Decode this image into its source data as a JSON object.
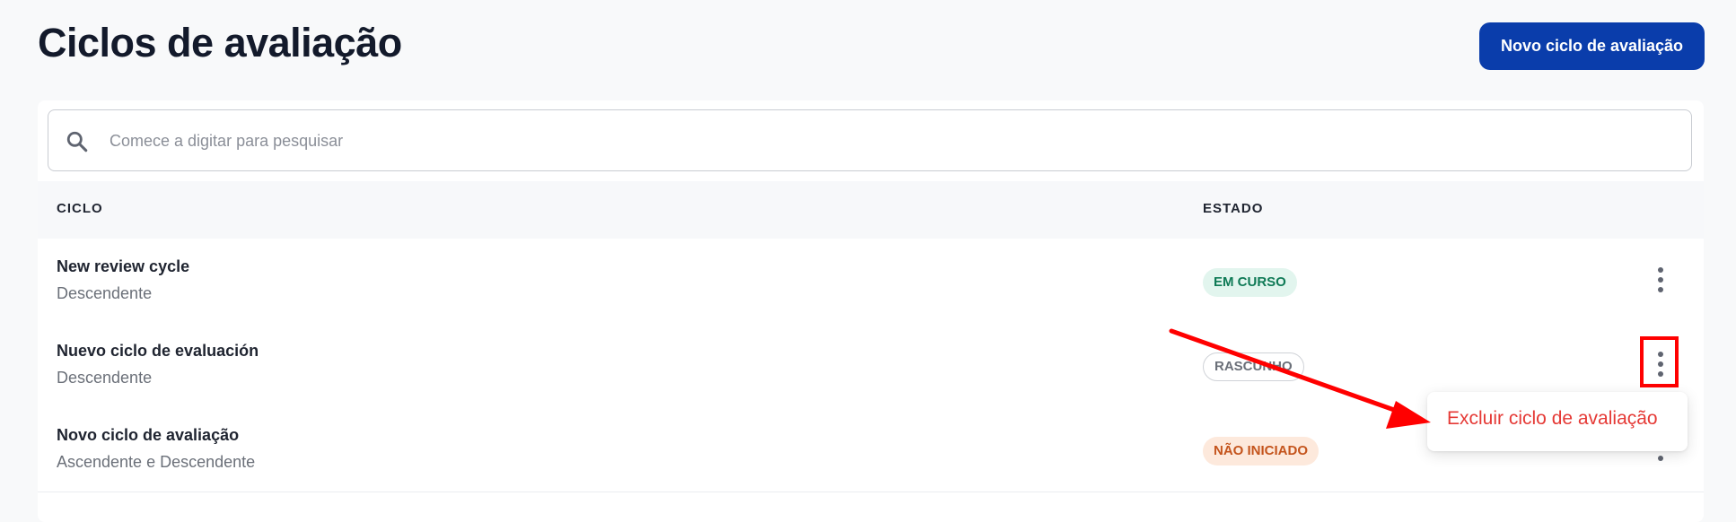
{
  "header": {
    "title": "Ciclos de avaliação",
    "new_button_label": "Novo ciclo de avaliação"
  },
  "search": {
    "placeholder": "Comece a digitar para pesquisar",
    "value": ""
  },
  "table": {
    "columns": [
      "CICLO",
      "ESTADO"
    ],
    "rows": [
      {
        "title": "New review cycle",
        "type": "Descendente",
        "status": "EM CURSO",
        "status_color": "green"
      },
      {
        "title": "Nuevo ciclo de evaluación",
        "type": "Descendente",
        "status": "RASCUNHO",
        "status_color": "gray"
      },
      {
        "title": "Novo ciclo de avaliação",
        "type": "Ascendente e Descendente",
        "status": "NÃO INICIADO",
        "status_color": "orange"
      }
    ]
  },
  "context_menu": {
    "items": [
      "Excluir ciclo de avaliação"
    ]
  },
  "annotation": {
    "color": "#ff0000"
  },
  "colors": {
    "primary": "#0a3dab",
    "danger": "#e53935",
    "status_green_bg": "#e2f5ee",
    "status_orange_bg": "#fde9dc"
  },
  "icons": [
    "search-icon",
    "more-vertical-icon"
  ]
}
